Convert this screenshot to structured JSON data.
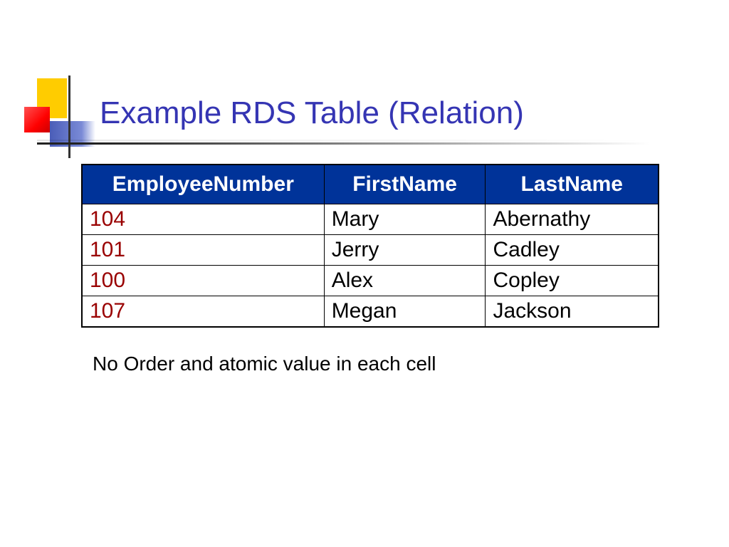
{
  "title": "Example RDS Table (Relation)",
  "chart_data": {
    "type": "table",
    "headers": [
      "EmployeeNumber",
      "FirstName",
      "LastName"
    ],
    "rows": [
      {
        "EmployeeNumber": "104",
        "FirstName": "Mary",
        "LastName": "Abernathy"
      },
      {
        "EmployeeNumber": "101",
        "FirstName": "Jerry",
        "LastName": "Cadley"
      },
      {
        "EmployeeNumber": "100",
        "FirstName": "Alex",
        "LastName": "Copley"
      },
      {
        "EmployeeNumber": "107",
        "FirstName": "Megan",
        "LastName": "Jackson"
      }
    ]
  },
  "caption": "No Order and atomic value in each cell",
  "colors": {
    "header_bg": "#003399",
    "header_fg": "#ffffff",
    "empnum_fg": "#990000",
    "title_fg": "#3535b3"
  }
}
